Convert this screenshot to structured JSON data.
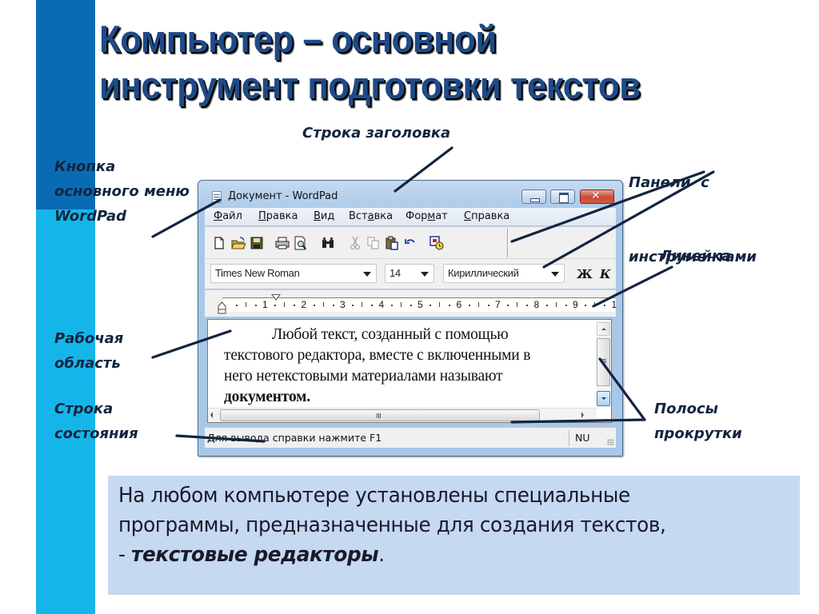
{
  "slide": {
    "title_lines": [
      "Компьютер – основной",
      "инструмент подготовки текстов"
    ],
    "colors": {
      "strip_dark": "#0a6bb5",
      "strip_light": "#14b6ea",
      "title": "#1f4a86",
      "callout_text": "#12243f",
      "leader_lines": "#12243f",
      "info_box_bg": "#c5d9f1"
    }
  },
  "callouts": {
    "main_menu_button": [
      "Кнопка",
      "основного меню",
      "WordPad"
    ],
    "title_bar": [
      "Строка заголовка"
    ],
    "toolbars": [
      "Панели  с",
      "инструментами"
    ],
    "ruler": [
      "Линейка"
    ],
    "work_area": [
      "Рабочая",
      "область"
    ],
    "status_bar": [
      "Строка",
      "состояния"
    ],
    "scrollbars": [
      "Полосы",
      "прокрутки"
    ]
  },
  "wordpad": {
    "window_title": "Документ - WordPad",
    "window_controls": {
      "minimize": "minimize-icon",
      "maximize": "maximize-icon",
      "close": "close-icon"
    },
    "menu": [
      {
        "label": "Файл",
        "accel": "Ф",
        "rest": "айл"
      },
      {
        "label": "Правка",
        "accel": "П",
        "rest": "равка"
      },
      {
        "label": "Вид",
        "accel": "В",
        "rest": "ид"
      },
      {
        "label": "Вставка",
        "pre": "Вст",
        "accel": "а",
        "rest": "вка"
      },
      {
        "label": "Формат",
        "pre": "Фор",
        "accel": "м",
        "rest": "ат"
      },
      {
        "label": "Справка",
        "accel": "С",
        "rest": "правка"
      }
    ],
    "toolbar_icons": [
      "new-document-icon",
      "open-folder-icon",
      "save-disk-icon",
      "print-icon",
      "print-preview-icon",
      "find-binoculars-icon",
      "cut-scissors-icon",
      "copy-icon",
      "paste-icon",
      "undo-icon",
      "date-time-icon"
    ],
    "format_bar": {
      "font_name": "Times New Roman",
      "font_size": "14",
      "script": "Кириллический",
      "bold_label": "Ж",
      "italic_label": "К"
    },
    "ruler": {
      "numbers": [
        "1",
        "2",
        "3",
        "4",
        "5",
        "6",
        "7",
        "8",
        "9",
        "1"
      ]
    },
    "document": {
      "line1": "Любой текст, созданный с помощью",
      "line2": "текстового редактора, вместе с включенными в",
      "line3": "него нетекстовыми материалами называют",
      "line4_bold": "документом."
    },
    "status_bar": {
      "help_text": "Для вывода справки нажмите F1",
      "num_lock": "NU"
    }
  },
  "info_box": {
    "line1": "На любом компьютере установлены специальные",
    "line2": "программы, предназначенные для создания текстов,",
    "line3_prefix": "- ",
    "line3_emphasis": "текстовые редакторы",
    "line3_suffix": "."
  }
}
